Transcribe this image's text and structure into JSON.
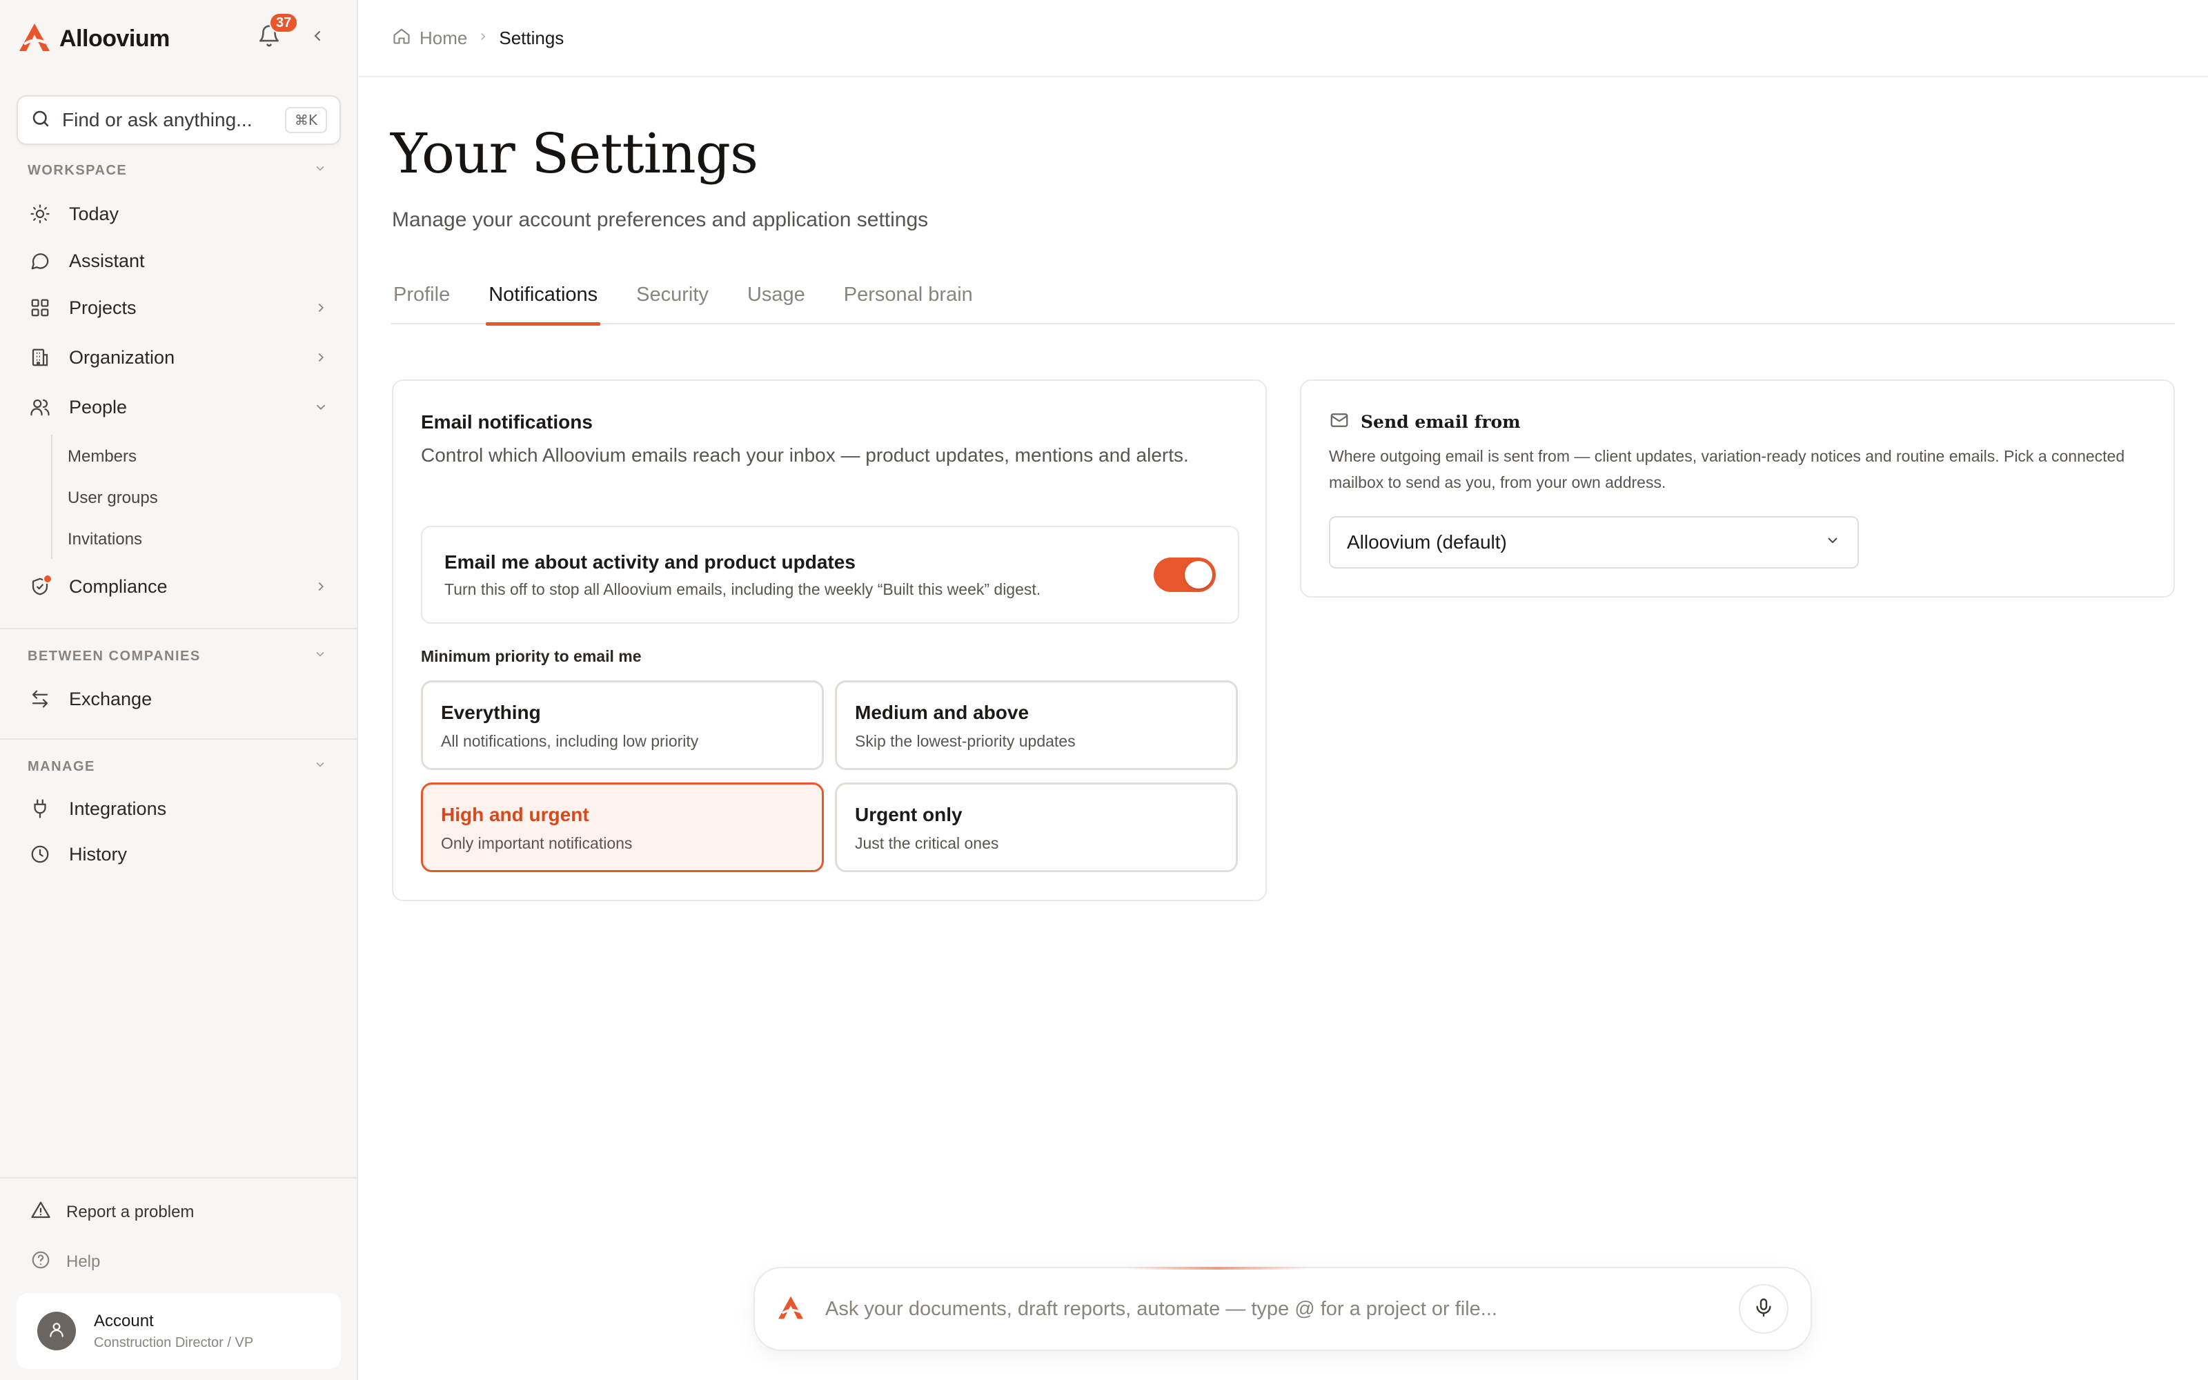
{
  "brand": {
    "name": "Alloovium",
    "accent": "#e8572c"
  },
  "notifications": {
    "count": "37"
  },
  "search": {
    "placeholder": "Find or ask anything...",
    "shortcut": "⌘K"
  },
  "sidebar": {
    "workspace_label": "WORKSPACE",
    "workspace": [
      {
        "label": "Today",
        "icon": "sun-icon"
      },
      {
        "label": "Assistant",
        "icon": "chat-bubble-icon"
      },
      {
        "label": "Projects",
        "icon": "grid-icon"
      },
      {
        "label": "Organization",
        "icon": "building-icon"
      },
      {
        "label": "People",
        "icon": "users-icon"
      }
    ],
    "people_sub": [
      "Members",
      "User groups",
      "Invitations"
    ],
    "compliance": {
      "label": "Compliance",
      "icon": "shield-check-icon"
    },
    "between_label": "BETWEEN COMPANIES",
    "exchange": {
      "label": "Exchange",
      "icon": "arrows-exchange-icon"
    },
    "manage_label": "MANAGE",
    "manage": [
      {
        "label": "Integrations",
        "icon": "plug-icon"
      },
      {
        "label": "History",
        "icon": "clock-icon"
      }
    ],
    "report": "Report a problem",
    "help": "Help",
    "account": {
      "name": "Account",
      "role": "Construction Director / VP"
    }
  },
  "breadcrumb": {
    "home": "Home",
    "current": "Settings"
  },
  "page": {
    "title": "Your Settings",
    "subtitle": "Manage your account preferences and application settings"
  },
  "tabs": [
    "Profile",
    "Notifications",
    "Security",
    "Usage",
    "Personal brain"
  ],
  "active_tab": "Notifications",
  "email_notifications": {
    "title": "Email notifications",
    "description": "Control which Alloovium emails reach your inbox — product updates, mentions and alerts.",
    "toggle": {
      "title": "Email me about activity and product updates",
      "description": "Turn this off to stop all Alloovium emails, including the weekly “Built this week” digest.",
      "enabled": true
    },
    "priority_label": "Minimum priority to email me",
    "priorities": [
      {
        "title": "Everything",
        "description": "All notifications, including low priority"
      },
      {
        "title": "Medium and above",
        "description": "Skip the lowest-priority updates"
      },
      {
        "title": "High and urgent",
        "description": "Only important notifications"
      },
      {
        "title": "Urgent only",
        "description": "Just the critical ones"
      }
    ],
    "selected_priority": "High and urgent"
  },
  "send_email_from": {
    "title": "Send email from",
    "description": "Where outgoing email is sent from — client updates, variation-ready notices and routine emails. Pick a connected mailbox to send as you, from your own address.",
    "selected": "Alloovium (default)"
  },
  "composer": {
    "placeholder": "Ask your documents, draft reports, automate — type @ for a project or file..."
  }
}
